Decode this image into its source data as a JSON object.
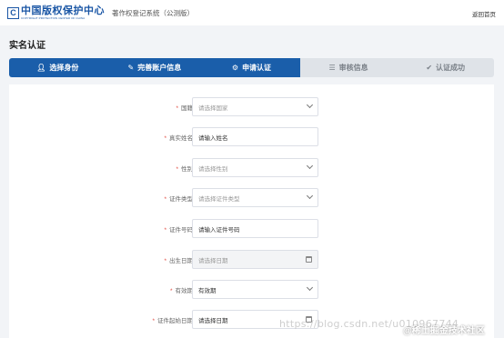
{
  "header": {
    "logo_cn": "中国版权保护中心",
    "logo_en": "COPYRIGHT PROTECTION CENTER OF CHINA",
    "system_title": "著作权登记系统（公测版）",
    "back_home": "返回首页"
  },
  "page_title": "实名认证",
  "steps": [
    {
      "label": "选择身份",
      "icon": "user-icon",
      "state": "active"
    },
    {
      "label": "完善账户信息",
      "icon": "user-edit-icon",
      "state": "active"
    },
    {
      "label": "申请认证",
      "icon": "gear-icon",
      "state": "active"
    },
    {
      "label": "审核信息",
      "icon": "review-icon",
      "state": "inactive"
    },
    {
      "label": "认证成功",
      "icon": "check-circle-icon",
      "state": "inactive"
    }
  ],
  "form": {
    "country": {
      "label": "国籍",
      "placeholder": "请选择国家"
    },
    "real_name": {
      "label": "真实姓名",
      "placeholder": "请输入姓名"
    },
    "gender": {
      "label": "性别",
      "placeholder": "请选择性别"
    },
    "id_type": {
      "label": "证件类型",
      "placeholder": "请选择证件类型"
    },
    "id_number": {
      "label": "证件号码",
      "placeholder": "请输入证件号码"
    },
    "birth_date": {
      "label": "出生日期",
      "placeholder": "请选择日期"
    },
    "validity": {
      "label": "有效期",
      "value": "有效期"
    },
    "id_start_date": {
      "label": "证件起始日期",
      "placeholder": "请选择日期"
    }
  },
  "watermark": {
    "url": "https://blog.csdn.net/u010967744",
    "community": "@稀土掘金技术社区"
  },
  "colors": {
    "accent": "#1a5eaa",
    "required": "#e04a3f",
    "inactive_step": "#dfe3e8"
  }
}
